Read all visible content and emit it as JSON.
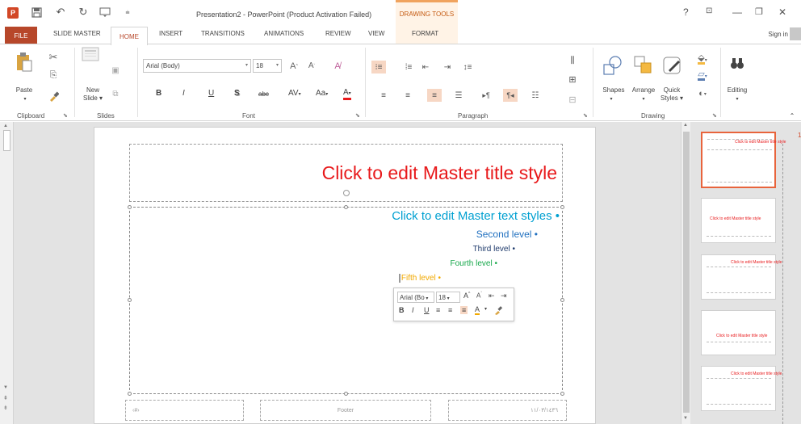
{
  "titlebar": {
    "app_icon_label": "P",
    "title": "Presentation2 - PowerPoint (Product Activation Failed)",
    "contextual_group": "DRAWING TOOLS",
    "help": "?",
    "restore_ribbon": "⊡",
    "minimize": "—",
    "maximize": "❐",
    "close": "✕"
  },
  "tabs": {
    "file": "FILE",
    "slide_master": "SLIDE MASTER",
    "home": "HOME",
    "insert": "INSERT",
    "transitions": "TRANSITIONS",
    "animations": "ANIMATIONS",
    "review": "REVIEW",
    "view": "VIEW",
    "format": "FORMAT",
    "sign_in": "Sign in"
  },
  "ribbon": {
    "clipboard": {
      "label": "Clipboard",
      "paste": "Paste"
    },
    "slides": {
      "label": "Slides",
      "new_slide_line1": "New",
      "new_slide_line2": "Slide ▾"
    },
    "font": {
      "label": "Font",
      "font_name": "Arial (Body)",
      "font_size": "18",
      "bold": "B",
      "italic": "I",
      "underline": "U",
      "shadow": "S",
      "strike": "abc",
      "spacing": "AV",
      "case": "Aa",
      "color": "A"
    },
    "paragraph": {
      "label": "Paragraph"
    },
    "drawing": {
      "label": "Drawing",
      "shapes": "Shapes",
      "arrange": "Arrange",
      "quick_styles_line1": "Quick",
      "quick_styles_line2": "Styles ▾"
    },
    "editing": {
      "label": "Editing"
    }
  },
  "slide": {
    "title": "Click to edit Master title style",
    "level1": "Click to edit Master text styles •",
    "level2": "Second level •",
    "level3": "Third level •",
    "level4": "Fourth level •",
    "level5": "Fifth level •",
    "date": "‏‹#›",
    "footer": "Footer",
    "slide_number": "١١/٠٣/١٤٣٦"
  },
  "mini_toolbar": {
    "font_name": "Arial (Bo",
    "font_size": "18",
    "bold": "B",
    "italic": "I",
    "underline": "U",
    "color": "A"
  },
  "thumbnails": {
    "selected_number": "1",
    "items": [
      {
        "title": "Click to edit Master title style"
      },
      {
        "title": "Click to edit Master title style"
      },
      {
        "title": "Click to edit Master title style"
      },
      {
        "title": "Click to edit Master title style"
      },
      {
        "title": "Click to edit Master title style"
      }
    ]
  },
  "colors": {
    "brand": "#b7472a",
    "title_red": "#e8191b",
    "level1": "#00a0d1",
    "level2": "#1f6fbf",
    "level3": "#1e3a6b",
    "level4": "#17a84b",
    "level5": "#f2a900",
    "selection": "#e8643c"
  }
}
